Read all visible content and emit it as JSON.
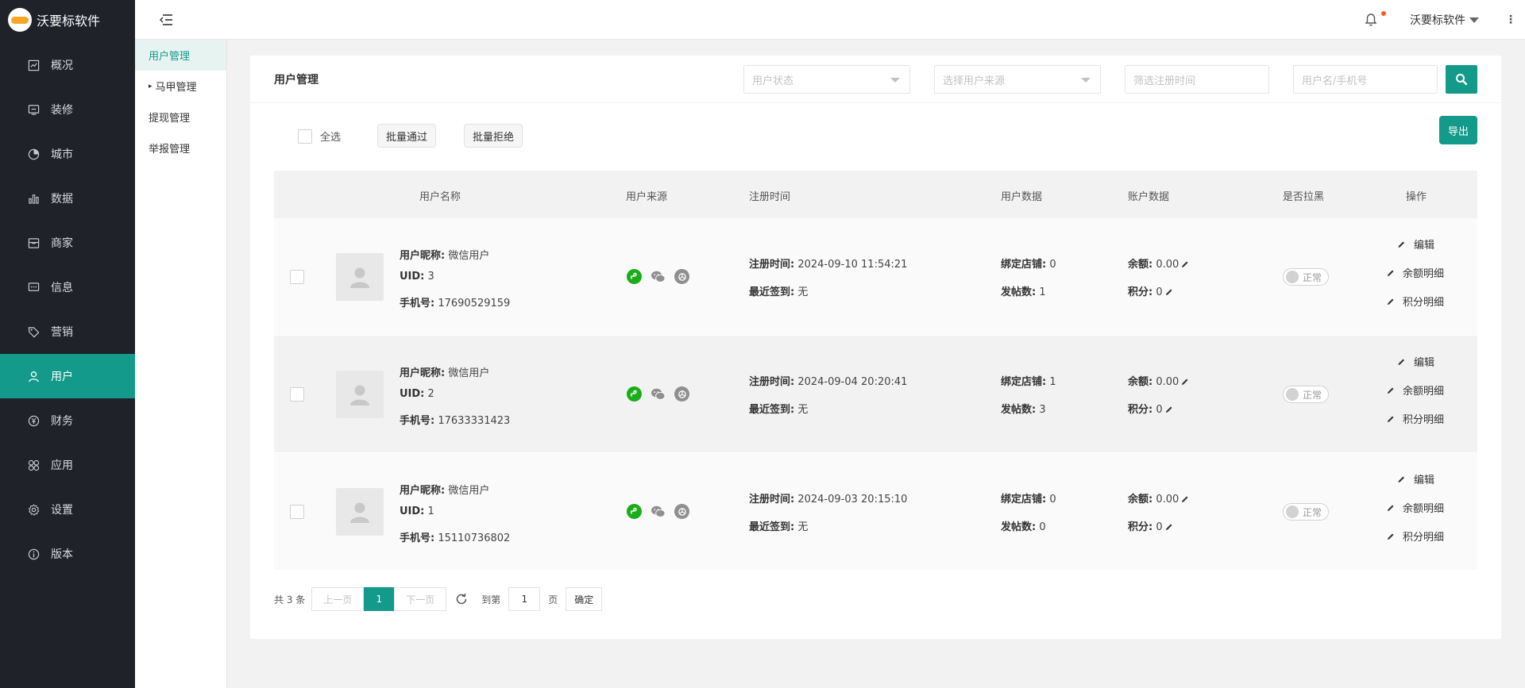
{
  "app": {
    "name": "沃要标软件"
  },
  "colors": {
    "accent": "#139a8a",
    "sidebar_bg": "#20222a",
    "notify_dot": "#ff5722",
    "wechat_green": "#1aad19"
  },
  "sidebar": {
    "items": [
      {
        "label": "概况",
        "icon": "overview-icon"
      },
      {
        "label": "装修",
        "icon": "decorate-icon"
      },
      {
        "label": "城市",
        "icon": "city-icon"
      },
      {
        "label": "数据",
        "icon": "chart-icon"
      },
      {
        "label": "商家",
        "icon": "store-icon"
      },
      {
        "label": "信息",
        "icon": "message-icon"
      },
      {
        "label": "营销",
        "icon": "tag-icon"
      },
      {
        "label": "用户",
        "icon": "user-icon",
        "active": true
      },
      {
        "label": "财务",
        "icon": "yen-icon"
      },
      {
        "label": "应用",
        "icon": "apps-icon"
      },
      {
        "label": "设置",
        "icon": "gear-icon"
      },
      {
        "label": "版本",
        "icon": "info-icon"
      }
    ]
  },
  "submenu": {
    "items": [
      {
        "label": "用户管理",
        "active": true
      },
      {
        "label": "马甲管理",
        "expandable": true
      },
      {
        "label": "提现管理"
      },
      {
        "label": "举报管理"
      }
    ]
  },
  "topbar": {
    "user_name": "沃要标软件"
  },
  "card": {
    "title": "用户管理",
    "filters": {
      "status_placeholder": "用户状态",
      "source_placeholder": "选择用户来源",
      "date_placeholder": "筛选注册时间",
      "search_placeholder": "用户名/手机号"
    },
    "toolbar": {
      "select_all": "全选",
      "batch_approve": "批量通过",
      "batch_reject": "批量拒绝",
      "export": "导出"
    }
  },
  "table": {
    "headers": {
      "username": "用户名称",
      "source": "用户来源",
      "reg_time": "注册时间",
      "user_data": "用户数据",
      "account_data": "账户数据",
      "blacklist": "是否拉黑",
      "actions": "操作"
    },
    "labels": {
      "nickname": "用户昵称:",
      "uid": "UID:",
      "phone": "手机号:",
      "reg_time": "注册时间:",
      "last_checkin": "最近签到:",
      "bound_stores": "绑定店铺:",
      "posts": "发帖数:",
      "balance": "余额:",
      "points": "积分:",
      "status_normal": "正常",
      "edit": "编辑",
      "balance_detail": "余额明细",
      "points_detail": "积分明细"
    },
    "rows": [
      {
        "nickname": "微信用户",
        "uid": "3",
        "phone": "17690529159",
        "reg_time": "2024-09-10 11:54:21",
        "last_checkin": "无",
        "bound_stores": "0",
        "posts": "1",
        "balance": "0.00",
        "points": "0"
      },
      {
        "nickname": "微信用户",
        "uid": "2",
        "phone": "17633331423",
        "reg_time": "2024-09-04 20:20:41",
        "last_checkin": "无",
        "bound_stores": "1",
        "posts": "3",
        "balance": "0.00",
        "points": "0"
      },
      {
        "nickname": "微信用户",
        "uid": "1",
        "phone": "15110736802",
        "reg_time": "2024-09-03 20:15:10",
        "last_checkin": "无",
        "bound_stores": "0",
        "posts": "0",
        "balance": "0.00",
        "points": "0"
      }
    ]
  },
  "pager": {
    "total": "共 3 条",
    "prev": "上一页",
    "current": "1",
    "next": "下一页",
    "goto_label": "到第",
    "goto_value": "1",
    "page_unit": "页",
    "confirm": "确定"
  }
}
